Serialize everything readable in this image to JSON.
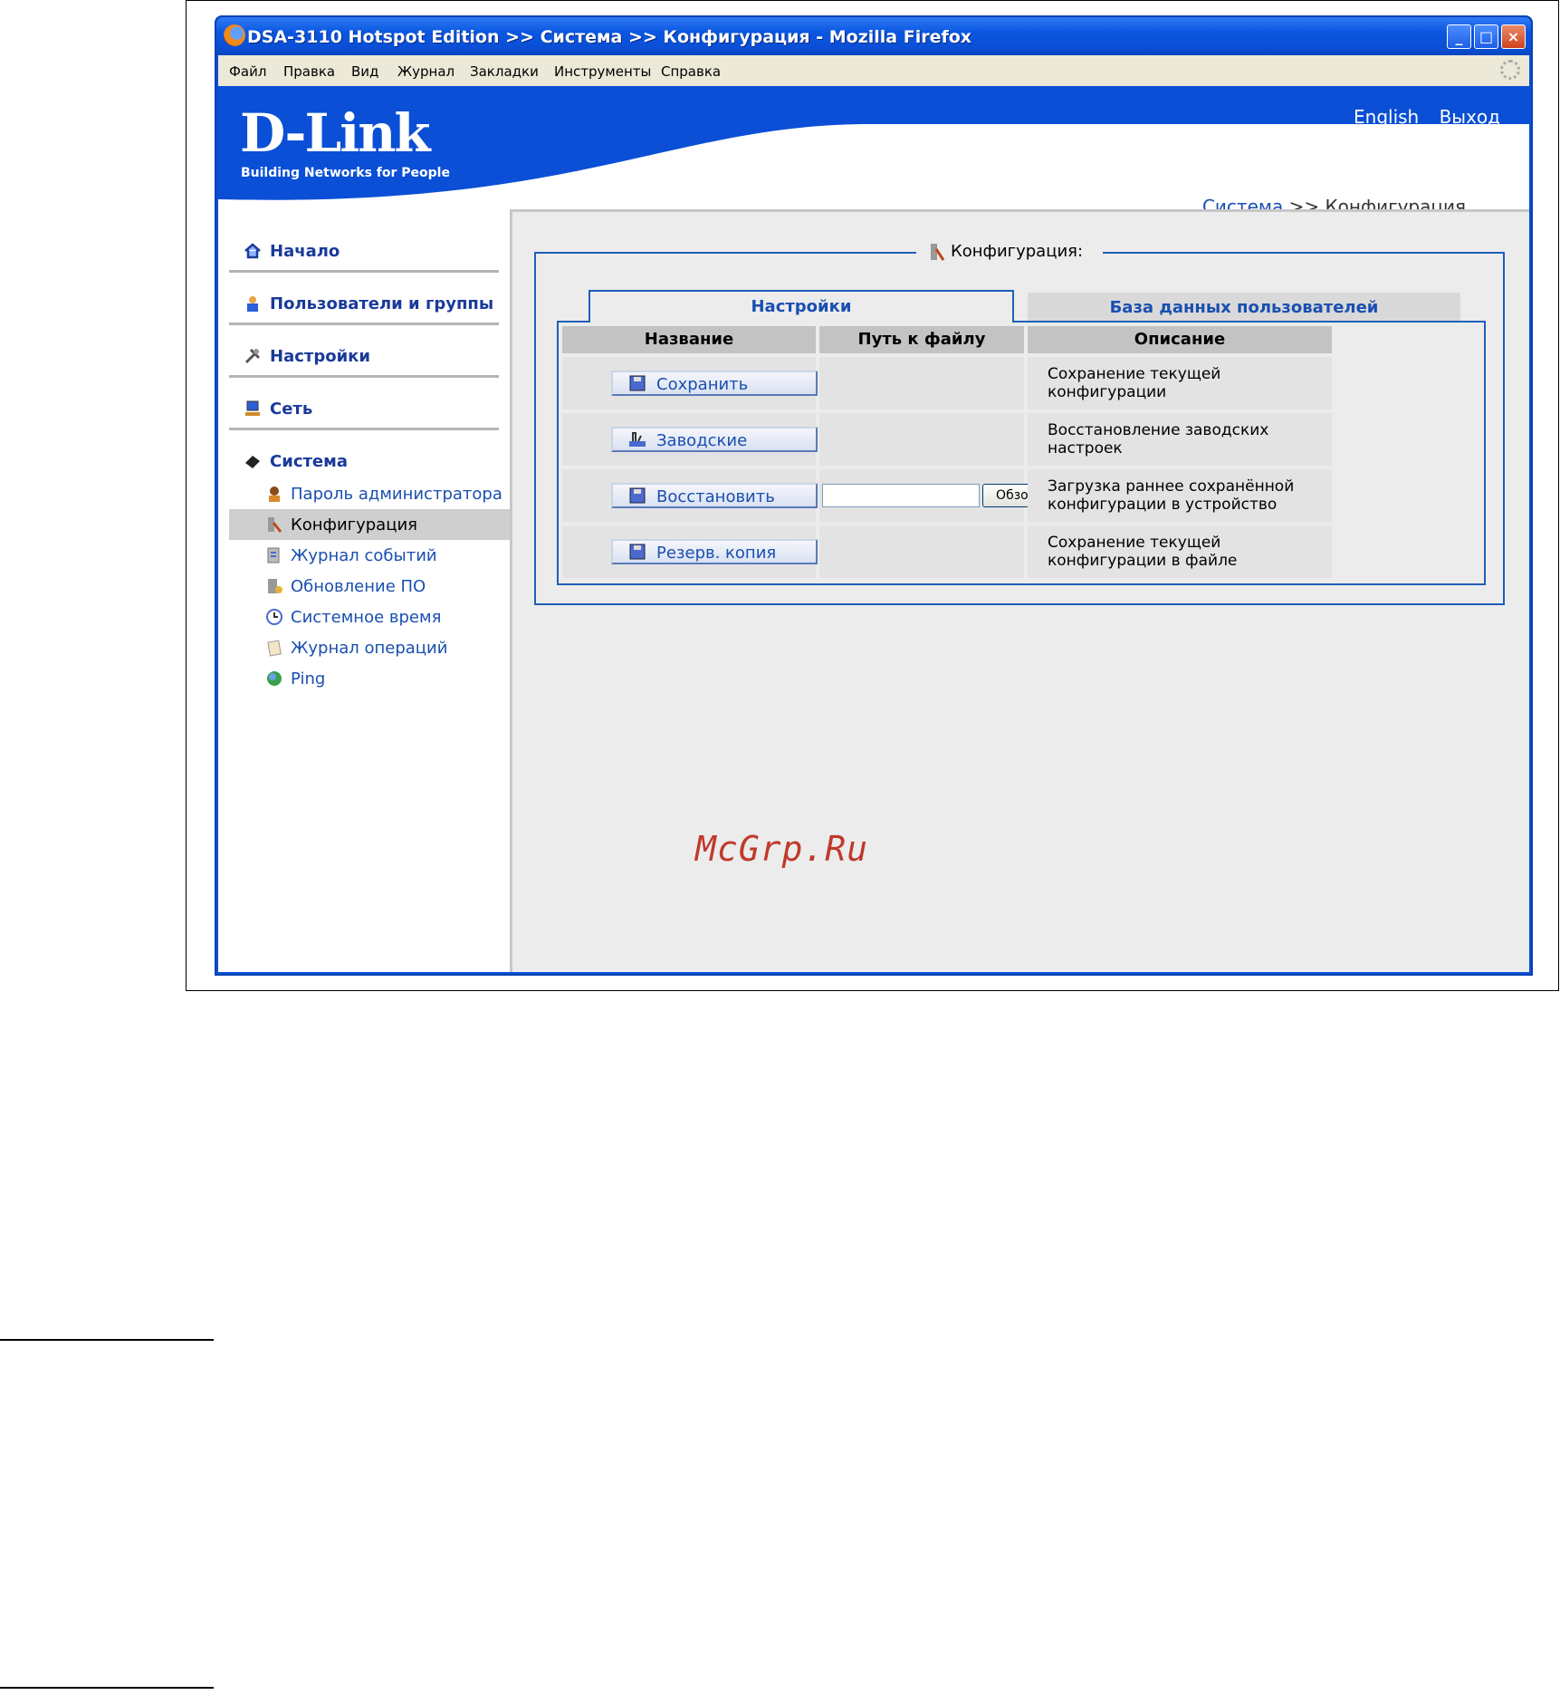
{
  "window": {
    "title": "DSA-3110 Hotspot Edition >> Система >> Конфигурация - Mozilla Firefox"
  },
  "menubar": [
    "Файл",
    "Правка",
    "Вид",
    "Журнал",
    "Закладки",
    "Инструменты",
    "Справка"
  ],
  "header": {
    "logo": "D-Link",
    "tagline": "Building Networks for People",
    "link_english": "English",
    "link_logout": "Выход",
    "breadcrumb_section": "Система",
    "breadcrumb_sep": " >> ",
    "breadcrumb_page": "Конфигурация"
  },
  "sidebar": {
    "main": [
      {
        "label": "Начало",
        "icon": "home-icon"
      },
      {
        "label": "Пользователи и группы",
        "icon": "users-icon"
      },
      {
        "label": "Настройки",
        "icon": "tools-icon"
      },
      {
        "label": "Сеть",
        "icon": "network-icon"
      },
      {
        "label": "Система",
        "icon": "system-icon"
      }
    ],
    "sub": [
      {
        "label": "Пароль администратора",
        "icon": "admin-icon"
      },
      {
        "label": "Конфигурация",
        "icon": "config-icon",
        "active": true
      },
      {
        "label": "Журнал событий",
        "icon": "event-log-icon"
      },
      {
        "label": "Обновление ПО",
        "icon": "firmware-icon"
      },
      {
        "label": "Системное время",
        "icon": "clock-icon"
      },
      {
        "label": "Журнал операций",
        "icon": "operations-log-icon"
      },
      {
        "label": "Ping",
        "icon": "ping-icon"
      }
    ]
  },
  "main": {
    "section_title": "Конфигурация:",
    "tabs": [
      "Настройки",
      "База данных пользователей"
    ],
    "columns": [
      "Название",
      "Путь к файлу",
      "Описание"
    ],
    "rows": [
      {
        "button": "Сохранить",
        "icon": "floppy-icon",
        "description": "Сохранение текущей конфигурации"
      },
      {
        "button": "Заводские",
        "icon": "factory-icon",
        "description": "Восстановление заводских настроек"
      },
      {
        "button": "Восстановить",
        "icon": "floppy-icon",
        "description": "Загрузка раннее сохранённой конфигурации в устройство",
        "file_input": true
      },
      {
        "button": "Резерв. копия",
        "icon": "floppy-icon",
        "description": "Сохранение текущей конфигурации в файле"
      }
    ],
    "browse_label": "Обзор..."
  },
  "watermark": "McGrp.Ru",
  "colors": {
    "brand_blue": "#0a4fd6",
    "link_blue": "#1a4fb0",
    "content_bg": "#ececec"
  }
}
